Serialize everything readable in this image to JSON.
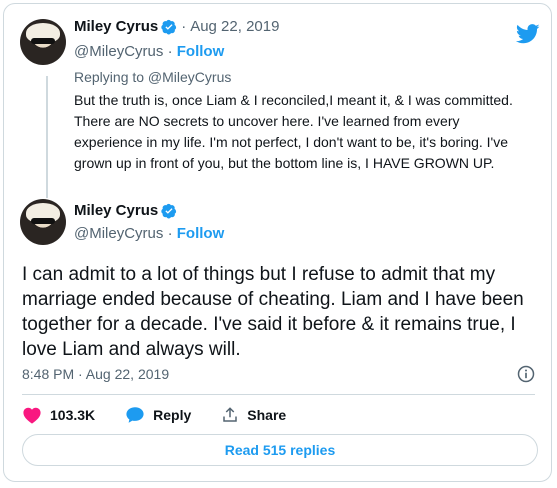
{
  "tweet_parent": {
    "author_name": "Miley Cyrus",
    "date_prefix": "·",
    "date": "Aug 22, 2019",
    "handle": "@MileyCyrus",
    "follow_sep": "·",
    "follow_label": "Follow",
    "replying_to": "Replying to @MileyCyrus",
    "text": "But the truth is, once Liam & I reconciled,I meant it, & I was committed. There are NO secrets to uncover here. I've learned from every experience in my life. I'm not perfect, I don't want to be, it's boring. I've grown up in front of you, but the bottom line is, I HAVE GROWN UP."
  },
  "tweet_main": {
    "author_name": "Miley Cyrus",
    "handle": "@MileyCyrus",
    "follow_sep": "·",
    "follow_label": "Follow",
    "text": "I can admit to a lot of things but I refuse to admit that my marriage ended because of cheating. Liam and I have been together for a decade. I've said it before & it remains true, I love Liam and always will.",
    "timestamp": "8:48 PM · Aug 22, 2019"
  },
  "actions": {
    "like_count": "103.3K",
    "reply_label": "Reply",
    "share_label": "Share"
  },
  "read_replies_label": "Read 515 replies",
  "colors": {
    "accent": "#1d9bf0",
    "like": "#f91880",
    "muted": "#536471",
    "border": "#cfd9de"
  },
  "icons": [
    "twitter-bird-icon",
    "verified-badge-icon",
    "info-icon",
    "heart-icon",
    "reply-bubble-icon",
    "share-icon"
  ]
}
